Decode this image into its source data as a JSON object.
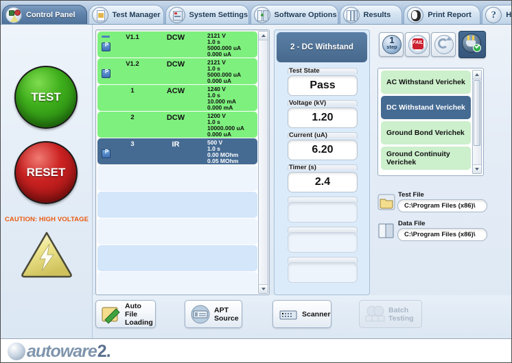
{
  "window": {
    "title": "Control Panel"
  },
  "tabs": [
    {
      "label": "Control Panel",
      "icon": "control-panel-icon",
      "active": true
    },
    {
      "label": "Test Manager",
      "icon": "test-manager-icon",
      "active": false
    },
    {
      "label": "System Settings",
      "icon": "system-settings-icon",
      "active": false
    },
    {
      "label": "Software Options",
      "icon": "software-options-icon",
      "active": false
    },
    {
      "label": "Results",
      "icon": "results-icon",
      "active": false
    },
    {
      "label": "Print Report",
      "icon": "print-report-icon",
      "active": false
    },
    {
      "label": "Help",
      "icon": "help-icon",
      "active": false
    }
  ],
  "left_panel": {
    "test_button": "TEST",
    "reset_button": "RESET",
    "caution_text": "CAUTION: HIGH VOLTAGE",
    "warning_icon": "high-voltage-warning-icon",
    "test_color": "#3faf1c",
    "reset_color": "#cc2222",
    "caution_color": "#ea5a10"
  },
  "test_list": {
    "rows": [
      {
        "id": "V1.1",
        "type": "DCW",
        "v1": "2121 V",
        "v2": "1.0 s",
        "v3": "5000.000 uA",
        "v4": "0.000 uA",
        "state": "pass",
        "badge": true,
        "dash": true
      },
      {
        "id": "V1.2",
        "type": "DCW",
        "v1": "2121 V",
        "v2": "1.0 s",
        "v3": "5000.000 uA",
        "v4": "0.000 uA",
        "state": "pass",
        "badge": true,
        "dash": false
      },
      {
        "id": "1",
        "type": "ACW",
        "v1": "1240 V",
        "v2": "1.0 s",
        "v3": "10.000 mA",
        "v4": "0.000 mA",
        "state": "pass",
        "badge": false,
        "dash": false
      },
      {
        "id": "2",
        "type": "DCW",
        "v1": "1200 V",
        "v2": "1.0 s",
        "v3": "10000.000 uA",
        "v4": "0.000 uA",
        "state": "pass",
        "badge": false,
        "dash": false
      },
      {
        "id": "3",
        "type": "IR",
        "v1": "500 V",
        "v2": "1.0 s",
        "v3": "0.00 MOhm",
        "v4": "0.05 MOhm",
        "state": "sel",
        "badge": true,
        "dash": false
      },
      {
        "id": "",
        "type": "",
        "v1": "",
        "v2": "",
        "v3": "",
        "v4": "",
        "state": "e0",
        "badge": false,
        "dash": false
      },
      {
        "id": "",
        "type": "",
        "v1": "",
        "v2": "",
        "v3": "",
        "v4": "",
        "state": "e1",
        "badge": false,
        "dash": false
      },
      {
        "id": "",
        "type": "",
        "v1": "",
        "v2": "",
        "v3": "",
        "v4": "",
        "state": "e0",
        "badge": false,
        "dash": false
      },
      {
        "id": "",
        "type": "",
        "v1": "",
        "v2": "",
        "v3": "",
        "v4": "",
        "state": "e1",
        "badge": false,
        "dash": false
      },
      {
        "id": "",
        "type": "",
        "v1": "",
        "v2": "",
        "v3": "",
        "v4": "",
        "state": "e0",
        "badge": false,
        "dash": false
      }
    ],
    "pass_color": "#7ef07e",
    "selected_color": "#456b93"
  },
  "readout": {
    "title": "2 - DC Withstand",
    "fields": [
      {
        "label": "Test State",
        "value": "Pass"
      },
      {
        "label": "Voltage (kV)",
        "value": "1.20"
      },
      {
        "label": "Current (uA)",
        "value": "6.20"
      },
      {
        "label": "Timer (s)",
        "value": "2.4"
      },
      {
        "label": "",
        "value": ""
      },
      {
        "label": "",
        "value": ""
      },
      {
        "label": "",
        "value": ""
      }
    ]
  },
  "mode_buttons": [
    {
      "name": "one-step-icon",
      "label": "1 step",
      "active": false
    },
    {
      "name": "fail-stop-icon",
      "label": "FAIL",
      "active": false
    },
    {
      "name": "cycle-icon",
      "label": "cycle",
      "active": false
    },
    {
      "name": "plug-check-icon",
      "label": "connect",
      "active": true
    }
  ],
  "program_list": {
    "items": [
      {
        "label": "AC Withstand Verichek",
        "selected": false
      },
      {
        "label": "DC Withstand Verichek",
        "selected": true
      },
      {
        "label": "Ground Bond Verichek",
        "selected": false
      },
      {
        "label": "Ground Continuity Verichek",
        "selected": false
      }
    ]
  },
  "files": [
    {
      "label": "Test File",
      "value": "C:\\Program Files (x86)\\",
      "icon": "folder-icon"
    },
    {
      "label": "Data File",
      "value": "C:\\Program Files (x86)\\",
      "icon": "data-file-icon"
    }
  ],
  "bottom_buttons": [
    {
      "label_line1": "Auto File",
      "label_line2": "Loading",
      "icon": "auto-file-loading-icon",
      "disabled": false
    },
    {
      "label_line1": "APT",
      "label_line2": "Source",
      "icon": "apt-source-icon",
      "disabled": false
    },
    {
      "label_line1": "Scanner",
      "label_line2": "",
      "icon": "scanner-icon",
      "disabled": false
    },
    {
      "label_line1": "Batch",
      "label_line2": "Testing",
      "icon": "batch-testing-icon",
      "disabled": true
    }
  ],
  "footer": {
    "brand": "autoware",
    "version": "2."
  }
}
